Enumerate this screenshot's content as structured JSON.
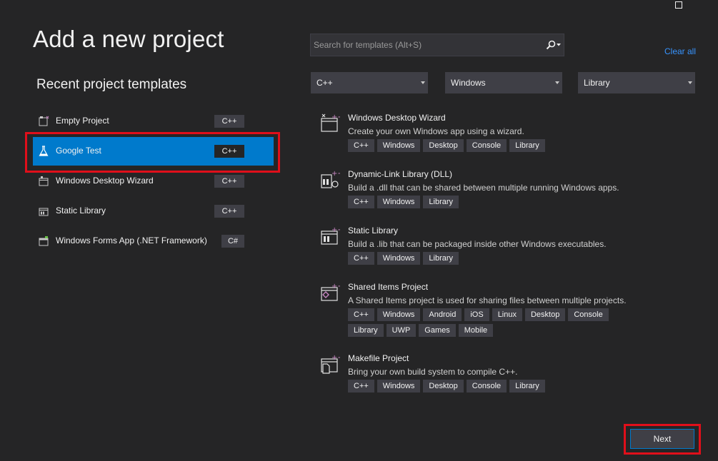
{
  "window": {
    "maximize_icon": "maximize-icon"
  },
  "header": {
    "title": "Add a new project",
    "subtitle": "Recent project templates"
  },
  "search": {
    "placeholder": "Search for templates (Alt+S)",
    "icon": "search-icon"
  },
  "clear_all": "Clear all",
  "filters": {
    "language": "C++",
    "platform": "Windows",
    "project_type": "Library"
  },
  "recent": [
    {
      "label": "Empty Project",
      "lang": "C++",
      "icon": "empty-project-icon",
      "selected": false
    },
    {
      "label": "Google Test",
      "lang": "C++",
      "icon": "flask-icon",
      "selected": true
    },
    {
      "label": "Windows Desktop Wizard",
      "lang": "C++",
      "icon": "desktop-wizard-icon",
      "selected": false
    },
    {
      "label": "Static Library",
      "lang": "C++",
      "icon": "static-library-icon",
      "selected": false
    },
    {
      "label": "Windows Forms App (.NET Framework)",
      "lang": "C#",
      "icon": "forms-app-icon",
      "selected": false
    }
  ],
  "templates": [
    {
      "title": "Windows Desktop Wizard",
      "description": "Create your own Windows app using a wizard.",
      "tags": [
        "C++",
        "Windows",
        "Desktop",
        "Console",
        "Library"
      ],
      "icon": "desktop-wizard-icon"
    },
    {
      "title": "Dynamic-Link Library (DLL)",
      "description": "Build a .dll that can be shared between multiple running Windows apps.",
      "tags": [
        "C++",
        "Windows",
        "Library"
      ],
      "icon": "dll-icon"
    },
    {
      "title": "Static Library",
      "description": "Build a .lib that can be packaged inside other Windows executables.",
      "tags": [
        "C++",
        "Windows",
        "Library"
      ],
      "icon": "static-library-icon"
    },
    {
      "title": "Shared Items Project",
      "description": "A Shared Items project is used for sharing files between multiple projects.",
      "tags": [
        "C++",
        "Windows",
        "Android",
        "iOS",
        "Linux",
        "Desktop",
        "Console",
        "Library",
        "UWP",
        "Games",
        "Mobile"
      ],
      "icon": "shared-items-icon"
    },
    {
      "title": "Makefile Project",
      "description": "Bring your own build system to compile C++.",
      "tags": [
        "C++",
        "Windows",
        "Desktop",
        "Console",
        "Library"
      ],
      "icon": "makefile-icon"
    }
  ],
  "next_button": "Next",
  "colors": {
    "background": "#252526",
    "accent": "#007acc",
    "highlight": "#e00f1a",
    "link": "#3794ff",
    "template_plus": "#c586c0"
  }
}
